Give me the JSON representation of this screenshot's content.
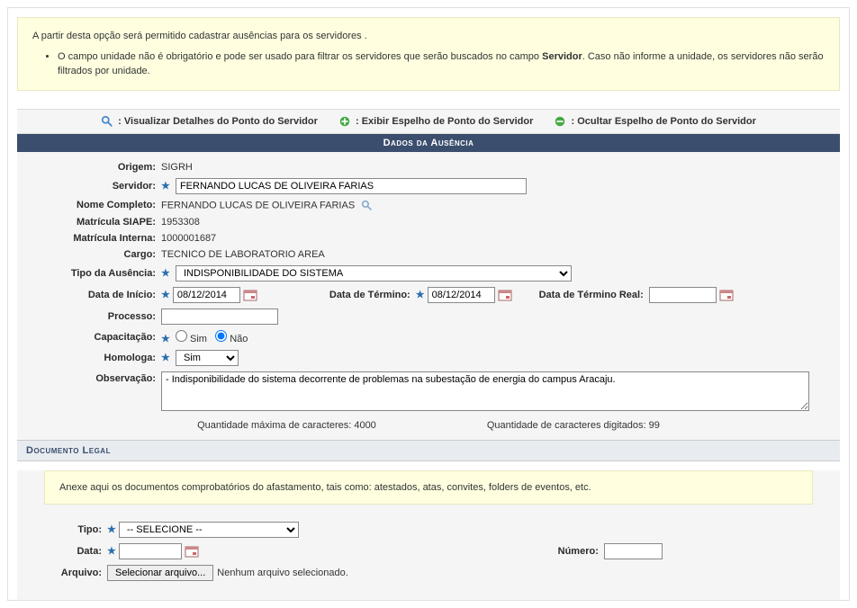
{
  "info": {
    "intro": "A partir desta opção será permitido cadastrar ausências para os servidores .",
    "bullet_prefix": "O campo unidade não é obrigatório e pode ser usado para filtrar os servidores que serão buscados no campo ",
    "bullet_bold": "Servidor",
    "bullet_suffix": ". Caso não informe a unidade, os servidores não serão filtrados por unidade."
  },
  "legend": {
    "detail": ": Visualizar Detalhes do Ponto do Servidor",
    "show": ": Exibir Espelho de Ponto do Servidor",
    "hide": ": Ocultar Espelho de Ponto do Servidor"
  },
  "section": {
    "ausencia_title": "Dados da Ausência",
    "doc_title": "Documento Legal"
  },
  "labels": {
    "origem": "Origem:",
    "servidor": "Servidor:",
    "nome_completo": "Nome Completo:",
    "matricula_siape": "Matrícula SIAPE:",
    "matricula_interna": "Matrícula Interna:",
    "cargo": "Cargo:",
    "tipo_ausencia": "Tipo da Ausência:",
    "data_inicio": "Data de Início:",
    "data_termino": "Data de Término:",
    "data_termino_real": "Data de Término Real:",
    "processo": "Processo:",
    "capacitacao": "Capacitação:",
    "homologa": "Homologa:",
    "observacao": "Observação:",
    "sim": "Sim",
    "nao": "Não",
    "tipo": "Tipo:",
    "data": "Data:",
    "numero": "Número:",
    "arquivo": "Arquivo:"
  },
  "values": {
    "origem": "SIGRH",
    "servidor": "FERNANDO LUCAS DE OLIVEIRA FARIAS",
    "nome_completo": "FERNANDO LUCAS DE OLIVEIRA FARIAS",
    "matricula_siape": "1953308",
    "matricula_interna": "1000001687",
    "cargo": "TECNICO DE LABORATORIO AREA",
    "tipo_ausencia": "INDISPONIBILIDADE DO SISTEMA",
    "data_inicio": "08/12/2014",
    "data_termino": "08/12/2014",
    "data_termino_real": "",
    "processo": "",
    "homologa": "Sim",
    "observacao": "- Indisponibilidade do sistema decorrente de problemas na subestação de energia do campus Aracaju.",
    "max_chars_label": "Quantidade máxima de caracteres: 4000",
    "typed_chars_label": "Quantidade de caracteres digitados: 99",
    "tipo_doc": "-- SELECIONE --",
    "file_btn": "Selecionar arquivo...",
    "file_none": "Nenhum arquivo selecionado."
  },
  "doc": {
    "intro": "Anexe aqui os documentos comprobatórios do afastamento, tais como: atestados, atas, convites, folders de eventos, etc."
  }
}
